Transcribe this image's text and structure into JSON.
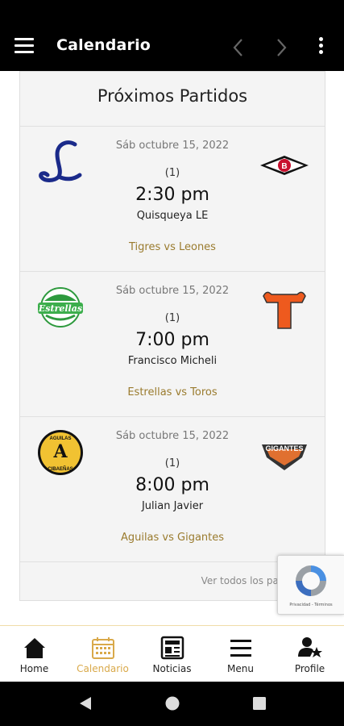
{
  "appbar": {
    "title": "Calendario",
    "menu_icon": "hamburger-menu-icon",
    "prev_icon": "chevron-left-icon",
    "next_icon": "chevron-right-icon",
    "more_icon": "more-vertical-icon"
  },
  "card": {
    "title": "Próximos Partidos",
    "see_all": "Ver todos los partidos",
    "games": [
      {
        "date": "Sáb octubre 15, 2022",
        "number": "(1)",
        "time": "2:30 pm",
        "venue": "Quisqueya LE",
        "matchup": "Tigres vs Leones",
        "home_logo": "leones-logo",
        "away_logo": "tigres-logo"
      },
      {
        "date": "Sáb octubre 15, 2022",
        "number": "(1)",
        "time": "7:00 pm",
        "venue": "Francisco Micheli",
        "matchup": "Estrellas vs Toros",
        "home_logo": "estrellas-logo",
        "away_logo": "toros-logo",
        "home_logo_text": "Estrellas"
      },
      {
        "date": "Sáb octubre 15, 2022",
        "number": "(1)",
        "time": "8:00 pm",
        "venue": "Julian Javier",
        "matchup": "Aguilas vs Gigantes",
        "home_logo": "aguilas-logo",
        "away_logo": "gigantes-logo",
        "home_logo_top": "AGUILAS",
        "home_logo_bottom": "CIBAEÑAS",
        "away_logo_text": "GIGANTES"
      }
    ]
  },
  "recaptcha": {
    "links": "Privacidad - Términos"
  },
  "bottomnav": {
    "items": [
      {
        "label": "Home",
        "icon": "home-icon",
        "active": false
      },
      {
        "label": "Calendario",
        "icon": "calendar-icon",
        "active": true
      },
      {
        "label": "Noticias",
        "icon": "newspaper-icon",
        "active": false
      },
      {
        "label": "Menu",
        "icon": "menu-icon",
        "active": false
      },
      {
        "label": "Profile",
        "icon": "profile-star-icon",
        "active": false
      }
    ]
  },
  "colors": {
    "appbar": "#000000",
    "accent": "#d9a94a",
    "matchup": "#9a7b2e",
    "card_bg": "#f4f4f4"
  }
}
